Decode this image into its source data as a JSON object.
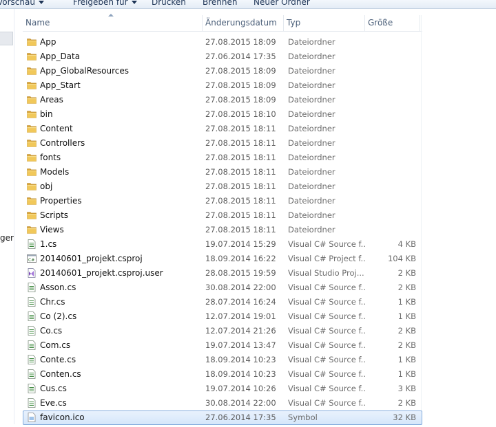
{
  "toolbar": {
    "items": [
      "Vorschau",
      "Freigeben für",
      "Drucken",
      "Brennen",
      "Neuer Ordner"
    ]
  },
  "nav": {
    "partial_label": "ger"
  },
  "columns": {
    "name": "Name",
    "date": "Änderungsdatum",
    "type": "Typ",
    "size": "Größe"
  },
  "files": [
    {
      "name": "App",
      "date": "27.08.2015 18:09",
      "type": "Dateiordner",
      "size": "",
      "icon": "folder-icon"
    },
    {
      "name": "App_Data",
      "date": "27.06.2014 17:35",
      "type": "Dateiordner",
      "size": "",
      "icon": "folder-icon"
    },
    {
      "name": "App_GlobalResources",
      "date": "27.08.2015 18:09",
      "type": "Dateiordner",
      "size": "",
      "icon": "folder-icon"
    },
    {
      "name": "App_Start",
      "date": "27.08.2015 18:09",
      "type": "Dateiordner",
      "size": "",
      "icon": "folder-icon"
    },
    {
      "name": "Areas",
      "date": "27.08.2015 18:09",
      "type": "Dateiordner",
      "size": "",
      "icon": "folder-icon"
    },
    {
      "name": "bin",
      "date": "27.08.2015 18:10",
      "type": "Dateiordner",
      "size": "",
      "icon": "folder-icon"
    },
    {
      "name": "Content",
      "date": "27.08.2015 18:11",
      "type": "Dateiordner",
      "size": "",
      "icon": "folder-icon"
    },
    {
      "name": "Controllers",
      "date": "27.08.2015 18:11",
      "type": "Dateiordner",
      "size": "",
      "icon": "folder-icon"
    },
    {
      "name": "fonts",
      "date": "27.08.2015 18:11",
      "type": "Dateiordner",
      "size": "",
      "icon": "folder-icon"
    },
    {
      "name": "Models",
      "date": "27.08.2015 18:11",
      "type": "Dateiordner",
      "size": "",
      "icon": "folder-icon"
    },
    {
      "name": "obj",
      "date": "27.08.2015 18:11",
      "type": "Dateiordner",
      "size": "",
      "icon": "folder-icon"
    },
    {
      "name": "Properties",
      "date": "27.08.2015 18:11",
      "type": "Dateiordner",
      "size": "",
      "icon": "folder-icon"
    },
    {
      "name": "Scripts",
      "date": "27.08.2015 18:11",
      "type": "Dateiordner",
      "size": "",
      "icon": "folder-icon"
    },
    {
      "name": "Views",
      "date": "27.08.2015 18:11",
      "type": "Dateiordner",
      "size": "",
      "icon": "folder-icon"
    },
    {
      "name": "1.cs",
      "date": "19.07.2014 15:29",
      "type": "Visual C# Source f...",
      "size": "4 KB",
      "icon": "cs-file-icon"
    },
    {
      "name": "20140601_projekt.csproj",
      "date": "18.09.2014 16:22",
      "type": "Visual C# Project f...",
      "size": "104 KB",
      "icon": "csproj-file-icon"
    },
    {
      "name": "20140601_projekt.csproj.user",
      "date": "28.08.2015 19:59",
      "type": "Visual Studio Proj...",
      "size": "2 KB",
      "icon": "vs-user-file-icon"
    },
    {
      "name": "Asson.cs",
      "date": "30.08.2014 22:00",
      "type": "Visual C# Source f...",
      "size": "2 KB",
      "icon": "cs-file-icon"
    },
    {
      "name": "Chr.cs",
      "date": "28.07.2014 16:24",
      "type": "Visual C# Source f...",
      "size": "1 KB",
      "icon": "cs-file-icon"
    },
    {
      "name": "Co (2).cs",
      "date": "12.07.2014 19:01",
      "type": "Visual C# Source f...",
      "size": "1 KB",
      "icon": "cs-file-icon"
    },
    {
      "name": "Co.cs",
      "date": "12.07.2014 21:26",
      "type": "Visual C# Source f...",
      "size": "2 KB",
      "icon": "cs-file-icon"
    },
    {
      "name": "Com.cs",
      "date": "19.07.2014 13:47",
      "type": "Visual C# Source f...",
      "size": "2 KB",
      "icon": "cs-file-icon"
    },
    {
      "name": "Conte.cs",
      "date": "18.09.2014 10:23",
      "type": "Visual C# Source f...",
      "size": "1 KB",
      "icon": "cs-file-icon"
    },
    {
      "name": "Conten.cs",
      "date": "18.09.2014 10:23",
      "type": "Visual C# Source f...",
      "size": "1 KB",
      "icon": "cs-file-icon"
    },
    {
      "name": "Cus.cs",
      "date": "19.07.2014 10:26",
      "type": "Visual C# Source f...",
      "size": "3 KB",
      "icon": "cs-file-icon"
    },
    {
      "name": "Eve.cs",
      "date": "30.08.2014 22:00",
      "type": "Visual C# Source f...",
      "size": "2 KB",
      "icon": "cs-file-icon"
    },
    {
      "name": "favicon.ico",
      "date": "27.06.2014 17:35",
      "type": "Symbol",
      "size": "32 KB",
      "icon": "ico-file-icon",
      "selected": true
    }
  ],
  "colors": {
    "folder": "#e8b84a",
    "selection": "#d5e6fa",
    "header_text": "#4c607a"
  }
}
